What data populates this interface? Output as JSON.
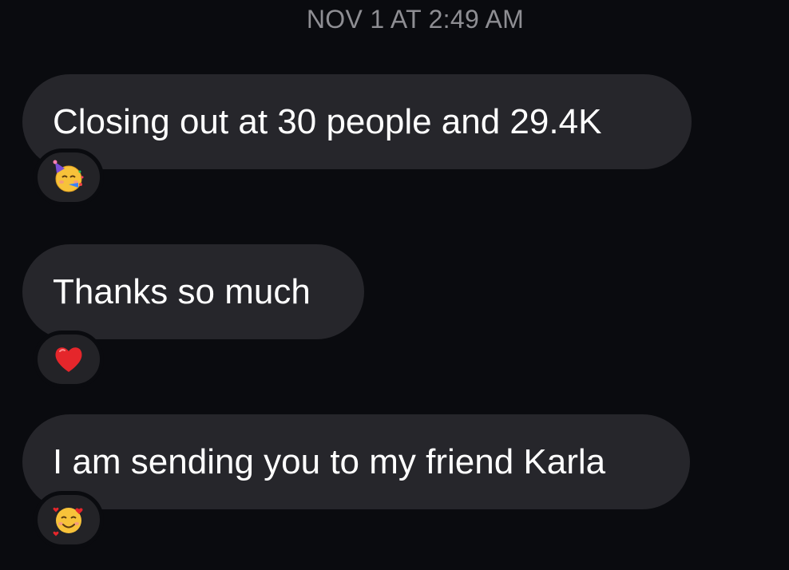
{
  "conversation": {
    "timestamp": "NOV 1 AT 2:49 AM",
    "messages": [
      {
        "text": "Closing out at 30 people and 29.4K",
        "reaction": "partying-face-emoji"
      },
      {
        "text": "Thanks so much",
        "reaction": "red-heart-emoji"
      },
      {
        "text": "I am sending you to my friend Karla",
        "reaction": "smiling-face-with-hearts-emoji"
      }
    ]
  },
  "colors": {
    "background": "#0a0b0f",
    "bubble": "#26262b",
    "timestamp": "#8e8e93",
    "text": "#ffffff"
  }
}
